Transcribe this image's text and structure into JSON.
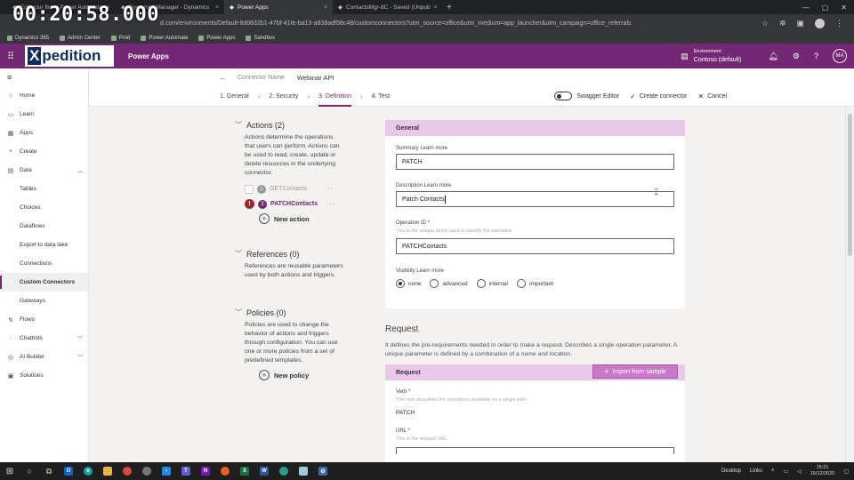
{
  "timer": "00:20:58.000",
  "browser": {
    "tabs": [
      {
        "title": "Edit your flow | Power Automate",
        "active": false
      },
      {
        "title": "Dynamics Manager - Dynamics",
        "active": false
      },
      {
        "title": "Power Apps",
        "active": true
      },
      {
        "title": "ContactsMgr-8C - Saved (Unpub",
        "active": false
      }
    ],
    "url": "d.com/environments/Default-8d0632b1-47bf-41fe-ba13-a838adf98c48/customconnectors?utm_source=office&utm_medium=app_launcher&utm_campaign=office_referrals",
    "bookmarks": [
      "Dynamics 365",
      "Admin Center",
      "Prod",
      "Power Automate",
      "Power Apps",
      "Sandbox"
    ]
  },
  "header": {
    "logo": "Xpedition",
    "app_name": "Power Apps",
    "env_label": "Environment",
    "env_name": "Contoso (default)",
    "avatar": "MA"
  },
  "nav": {
    "items": [
      {
        "label": "Home",
        "icon": "home-icon",
        "glyph": "⌂",
        "sub": false
      },
      {
        "label": "Learn",
        "icon": "book-icon",
        "glyph": "▭",
        "sub": false
      },
      {
        "label": "Apps",
        "icon": "apps-icon",
        "glyph": "▦",
        "sub": false
      },
      {
        "label": "Create",
        "icon": "plus-icon",
        "glyph": "+",
        "sub": false
      },
      {
        "label": "Data",
        "icon": "data-icon",
        "glyph": "▤",
        "sub": false,
        "chevron": "up"
      },
      {
        "label": "Tables",
        "sub": true
      },
      {
        "label": "Choices",
        "sub": true
      },
      {
        "label": "Dataflows",
        "sub": true
      },
      {
        "label": "Export to data lake",
        "sub": true
      },
      {
        "label": "Connections",
        "sub": true
      },
      {
        "label": "Custom Connectors",
        "sub": true,
        "active": true
      },
      {
        "label": "Gateways",
        "sub": true
      },
      {
        "label": "Flows",
        "icon": "flows-icon",
        "glyph": "↯",
        "sub": false
      },
      {
        "label": "Chatbots",
        "icon": "chatbot-icon",
        "glyph": "◌",
        "sub": false,
        "chevron": "down"
      },
      {
        "label": "AI Builder",
        "icon": "ai-icon",
        "glyph": "◎",
        "sub": false,
        "chevron": "down"
      },
      {
        "label": "Solutions",
        "icon": "solutions-icon",
        "glyph": "▣",
        "sub": false
      }
    ]
  },
  "connector": {
    "label": "Connector Name",
    "name": "Webinar API"
  },
  "steps": [
    "1. General",
    "2. Security",
    "3. Definition",
    "4. Test"
  ],
  "commands": {
    "swagger": "Swagger Editor",
    "create": "Create connector",
    "cancel": "Cancel"
  },
  "actions": {
    "title": "Actions (2)",
    "desc": "Actions determine the operations that users can perform. Actions can be used to read, create, update or delete resources in the underlying connector.",
    "items": [
      {
        "num": "1",
        "name": "GETContacts",
        "selected": false
      },
      {
        "num": "2",
        "name": "PATCHContacts",
        "selected": true
      }
    ],
    "new_label": "New action"
  },
  "references": {
    "title": "References (0)",
    "desc": "References are reusable parameters used by both actions and triggers."
  },
  "policies": {
    "title": "Policies (0)",
    "desc": "Policies are used to change the behavior of actions and triggers through configuration. You can use one or more policies from a set of predefined templates.",
    "new_label": "New policy"
  },
  "general": {
    "header": "General",
    "summary_label": "Summary Learn more",
    "summary_value": "PATCH",
    "description_label": "Description Learn more",
    "description_value": "Patch Contacts",
    "opid_label": "Operation ID *",
    "opid_hint": "This is the unique string used to identify the operation.",
    "opid_value": "PATCHContacts",
    "visibility_label": "Visibility Learn more",
    "visibility_options": [
      "none",
      "advanced",
      "internal",
      "important"
    ],
    "visibility_selected": "none"
  },
  "request": {
    "title": "Request",
    "desc": "It defines the pre-requirements needed in order to make a request. Describes a single operation parameter. A unique parameter is defined by a combination of a name and location.",
    "header": "Request",
    "import_label": "Import from sample",
    "verb_label": "Verb *",
    "verb_hint": "The verb describes the operations available on a single path.",
    "verb_value": "PATCH",
    "url_label": "URL *",
    "url_hint": "This is the request URL."
  },
  "taskbar": {
    "desktop": "Desktop",
    "links": "Links",
    "time": "15:21",
    "date": "15/12/2020"
  }
}
